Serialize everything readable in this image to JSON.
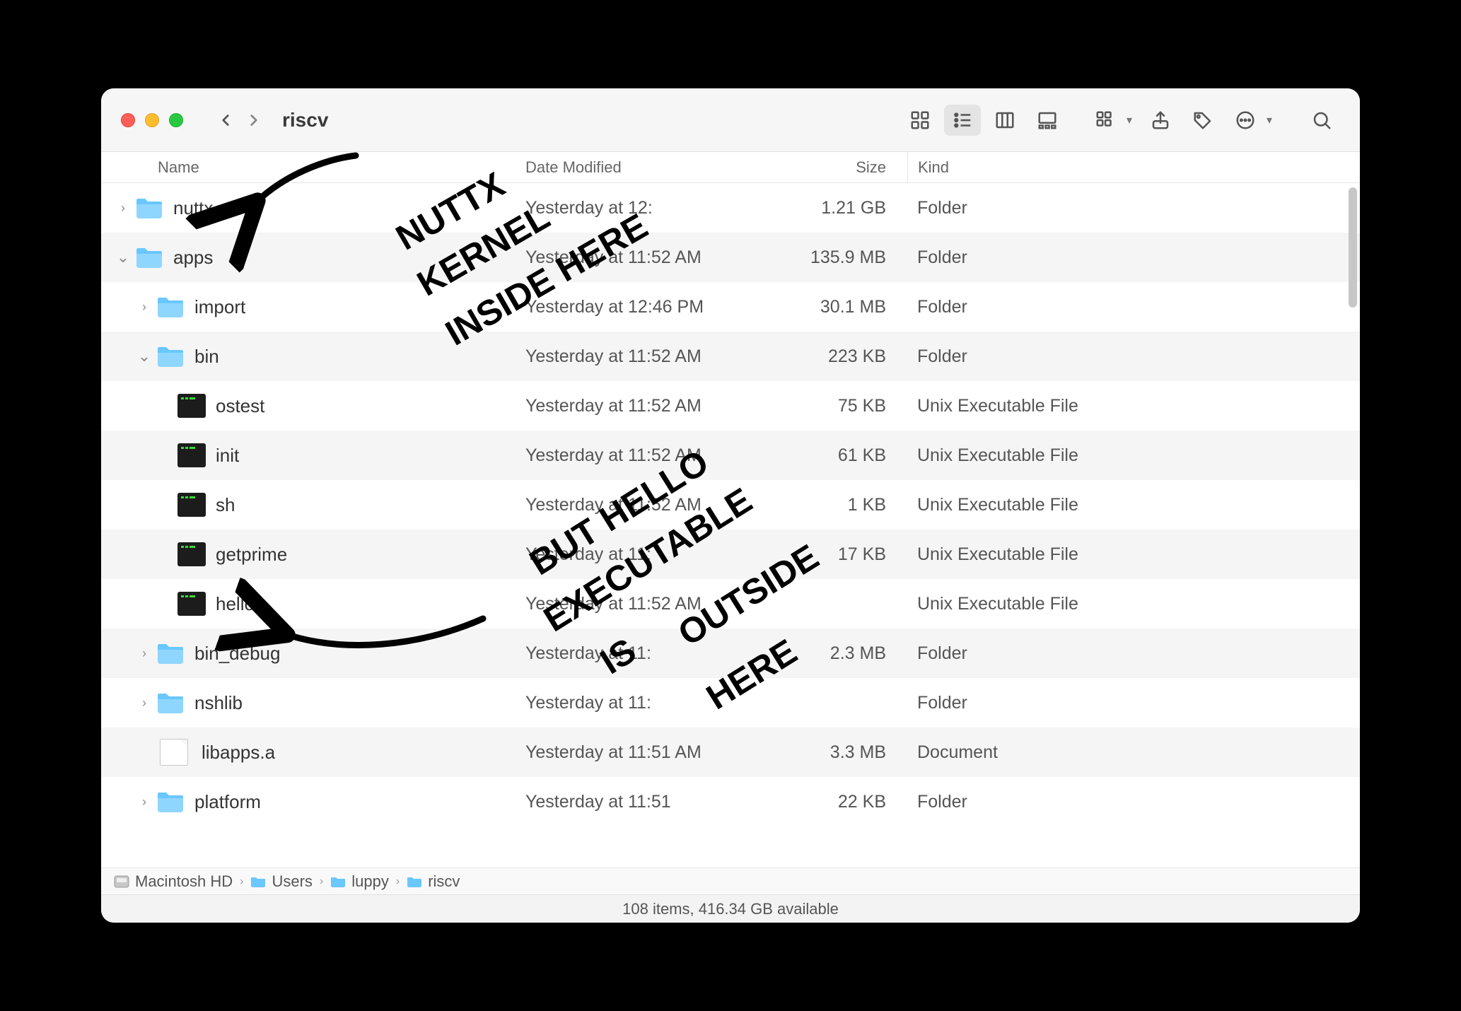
{
  "window": {
    "title": "riscv"
  },
  "columns": {
    "name": "Name",
    "date": "Date Modified",
    "size": "Size",
    "kind": "Kind"
  },
  "rows": [
    {
      "indent": 0,
      "disclosure": "right",
      "icon": "folder",
      "name": "nuttx",
      "date": "Yesterday at 12:",
      "size": "1.21 GB",
      "kind": "Folder",
      "alt": false
    },
    {
      "indent": 0,
      "disclosure": "down",
      "icon": "folder",
      "name": "apps",
      "date": "Yesterday at 11:52 AM",
      "size": "135.9 MB",
      "kind": "Folder",
      "alt": true
    },
    {
      "indent": 1,
      "disclosure": "right",
      "icon": "folder",
      "name": "import",
      "date": "Yesterday at 12:46 PM",
      "size": "30.1 MB",
      "kind": "Folder",
      "alt": false
    },
    {
      "indent": 1,
      "disclosure": "down",
      "icon": "folder",
      "name": "bin",
      "date": "Yesterday at 11:52 AM",
      "size": "223 KB",
      "kind": "Folder",
      "alt": true
    },
    {
      "indent": 2,
      "disclosure": "",
      "icon": "exec",
      "name": "ostest",
      "date": "Yesterday at 11:52 AM",
      "size": "75 KB",
      "kind": "Unix Executable File",
      "alt": false
    },
    {
      "indent": 2,
      "disclosure": "",
      "icon": "exec",
      "name": "init",
      "date": "Yesterday at 11:52 AM",
      "size": "61 KB",
      "kind": "Unix Executable File",
      "alt": true
    },
    {
      "indent": 2,
      "disclosure": "",
      "icon": "exec",
      "name": "sh",
      "date": "Yesterday at 11:52 AM",
      "size": "1 KB",
      "kind": "Unix Executable File",
      "alt": false
    },
    {
      "indent": 2,
      "disclosure": "",
      "icon": "exec",
      "name": "getprime",
      "date": "Yesterday at 11:",
      "size": "17 KB",
      "kind": "Unix Executable File",
      "alt": true
    },
    {
      "indent": 2,
      "disclosure": "",
      "icon": "exec",
      "name": "hello",
      "date": "Yesterday at 11:52 AM",
      "size": "",
      "kind": "Unix Executable File",
      "alt": false
    },
    {
      "indent": 1,
      "disclosure": "right",
      "icon": "folder",
      "name": "bin_debug",
      "date": "Yesterday at 11:",
      "size": "2.3 MB",
      "kind": "Folder",
      "alt": true
    },
    {
      "indent": 1,
      "disclosure": "right",
      "icon": "folder",
      "name": "nshlib",
      "date": "Yesterday at 11:",
      "size": "",
      "kind": "Folder",
      "alt": false
    },
    {
      "indent": 1,
      "disclosure": "",
      "icon": "doc",
      "name": "libapps.a",
      "date": "Yesterday at 11:51 AM",
      "size": "3.3 MB",
      "kind": "Document",
      "alt": true
    },
    {
      "indent": 1,
      "disclosure": "right",
      "icon": "folder",
      "name": "platform",
      "date": "Yesterday at 11:51",
      "size": "22 KB",
      "kind": "Folder",
      "alt": false
    }
  ],
  "path": [
    {
      "icon": "disk",
      "label": "Macintosh HD"
    },
    {
      "icon": "folder",
      "label": "Users"
    },
    {
      "icon": "folder",
      "label": "luppy"
    },
    {
      "icon": "folder",
      "label": "riscv"
    }
  ],
  "status": "108 items, 416.34 GB available",
  "annotations": {
    "note1": "NUTTX KERNEL INSIDE HERE",
    "note2": "BUT HELLO EXECUTABLE IS OUTSIDE HERE"
  }
}
